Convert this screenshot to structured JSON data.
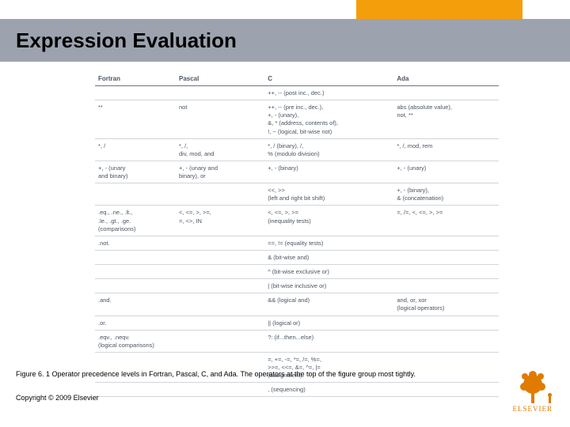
{
  "slide": {
    "title": "Expression Evaluation",
    "caption": "Figure 6. 1 Operator precedence levels in Fortran, Pascal, C, and Ada. The operators at the top of the figure group most tightly.",
    "copyright": "Copyright © 2009 Elsevier",
    "logo_text": "ELSEVIER"
  },
  "chart_data": {
    "type": "table",
    "title": "Operator precedence levels",
    "columns": [
      "Fortran",
      "Pascal",
      "C",
      "Ada"
    ],
    "rows": [
      {
        "Fortran": "",
        "Pascal": "",
        "C": "++, -- (post inc., dec.)",
        "Ada": ""
      },
      {
        "Fortran": "**",
        "Pascal": "not",
        "C": "++, -- (pre inc., dec.),\n+, - (unary),\n&, * (address, contents of),\n!, ~ (logical, bit-wise not)",
        "Ada": "abs (absolute value),\nnot, **"
      },
      {
        "Fortran": "*, /",
        "Pascal": "*, /,\ndiv, mod, and",
        "C": "*, / (binary), /,\n% (modulo division)",
        "Ada": "*, /, mod, rem"
      },
      {
        "Fortran": "+, - (unary\nand binary)",
        "Pascal": "+, - (unary and\nbinary), or",
        "C": "+, - (binary)",
        "Ada": "+, - (unary)"
      },
      {
        "Fortran": "",
        "Pascal": "",
        "C": "<<, >>\n(left and right bit shift)",
        "Ada": "+, - (binary),\n& (concatenation)"
      },
      {
        "Fortran": ".eq., .ne., .lt.,\n.le., .gt., .ge.\n(comparisons)",
        "Pascal": "<, <=, >, >=,\n=, <>, IN",
        "C": "<, <=, >, >=\n(inequality tests)",
        "Ada": "=, /=, <, <=, >, >="
      },
      {
        "Fortran": ".not.",
        "Pascal": "",
        "C": "==, != (equality tests)",
        "Ada": ""
      },
      {
        "Fortran": "",
        "Pascal": "",
        "C": "& (bit-wise and)",
        "Ada": ""
      },
      {
        "Fortran": "",
        "Pascal": "",
        "C": "^ (bit-wise exclusive or)",
        "Ada": ""
      },
      {
        "Fortran": "",
        "Pascal": "",
        "C": "| (bit-wise inclusive or)",
        "Ada": ""
      },
      {
        "Fortran": ".and.",
        "Pascal": "",
        "C": "&& (logical and)",
        "Ada": "and, or, xor\n(logical operators)"
      },
      {
        "Fortran": ".or.",
        "Pascal": "",
        "C": "|| (logical or)",
        "Ada": ""
      },
      {
        "Fortran": ".eqv., .neqv.\n(logical comparisons)",
        "Pascal": "",
        "C": "?: (if...then...else)",
        "Ada": ""
      },
      {
        "Fortran": "",
        "Pascal": "",
        "C": "=, +=, -=, *=, /=, %=,\n>>=, <<=, &=, ^=, |=\n(assignment)",
        "Ada": ""
      },
      {
        "Fortran": "",
        "Pascal": "",
        "C": ", (sequencing)",
        "Ada": ""
      }
    ]
  }
}
